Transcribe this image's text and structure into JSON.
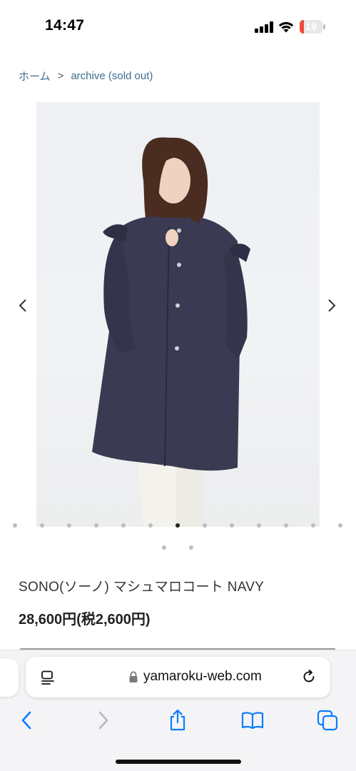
{
  "status_bar": {
    "time": "14:47",
    "battery_level": "19",
    "battery_fraction": 0.19,
    "icons": [
      "cellular-signal-icon",
      "wifi-icon",
      "battery-icon"
    ]
  },
  "breadcrumb": {
    "items": [
      "ホーム",
      "archive (sold out)"
    ],
    "separator": ">"
  },
  "gallery": {
    "prev_icon": "chevron-left-icon",
    "next_icon": "chevron-right-icon",
    "total_images": 15,
    "active_index": 6
  },
  "product": {
    "title": "SONO(ソーノ) マシュマロコート  NAVY",
    "price": "28,600円(税2,600円)"
  },
  "browser": {
    "url": "yamaroku-web.com",
    "icons": [
      "page-menu-icon",
      "lock-icon",
      "reload-icon",
      "back-icon",
      "forward-icon",
      "share-icon",
      "bookmarks-icon",
      "tabs-icon"
    ]
  },
  "colors": {
    "link": "#3d6d8c",
    "ios_blue": "#0a7cff",
    "battery_low": "#eb4d3d",
    "coat_navy": "#3a3a52"
  }
}
